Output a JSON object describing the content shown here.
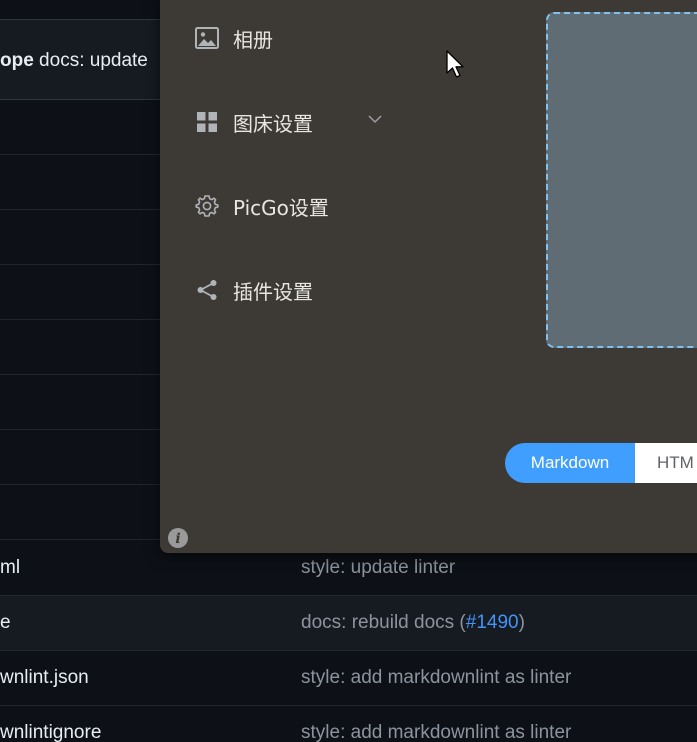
{
  "background": {
    "header_commit": {
      "scope": "ope",
      "message": " docs: update"
    },
    "rows": [
      {
        "file": "",
        "msg": ""
      },
      {
        "file": "",
        "msg": ""
      },
      {
        "file": "",
        "msg": ""
      },
      {
        "file": "",
        "msg": ""
      },
      {
        "file": "",
        "msg": ""
      },
      {
        "file": "",
        "msg": ""
      },
      {
        "file": "",
        "msg": ""
      },
      {
        "file": "ml",
        "msg": "style: update linter"
      },
      {
        "file": "e",
        "msg": "docs: rebuild docs (",
        "ref": "#1490",
        "msg_end": ")"
      },
      {
        "file": "wnlint.json",
        "msg": "style: add markdownlint as linter"
      },
      {
        "file": "wnlintignore",
        "msg": "style: add markdownlint as linter"
      }
    ]
  },
  "picgo": {
    "menu": [
      {
        "label": "相册",
        "icon": "image-icon"
      },
      {
        "label": "图床设置",
        "icon": "grid-icon"
      },
      {
        "label": "PicGo设置",
        "icon": "gear-icon"
      },
      {
        "label": "插件设置",
        "icon": "share-icon"
      }
    ],
    "format_toggle": {
      "active": "Markdown",
      "inactive": "HTM"
    }
  },
  "colors": {
    "window_bg": "#3d3a35",
    "accent": "#409eff",
    "upload_area": "#5f6c74",
    "upload_border": "#7fc1f0",
    "link": "#4493f8"
  }
}
